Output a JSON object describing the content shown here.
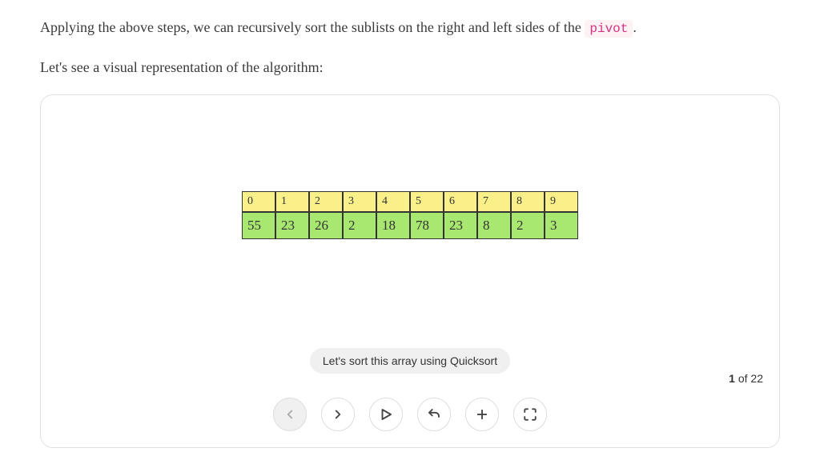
{
  "intro": {
    "paragraph1_prefix": "Applying the above steps, we can recursively sort the sublists on the right and left sides of the ",
    "code_token": "pivot",
    "paragraph1_suffix": ".",
    "paragraph2": "Let's see a visual representation of the algorithm:"
  },
  "array": {
    "indices": [
      "0",
      "1",
      "2",
      "3",
      "4",
      "5",
      "6",
      "7",
      "8",
      "9"
    ],
    "values": [
      "55",
      "23",
      "26",
      "2",
      "18",
      "78",
      "23",
      "8",
      "2",
      "3"
    ]
  },
  "caption": "Let's sort this array using Quicksort",
  "pager": {
    "current": "1",
    "of_label": "of",
    "total": "22"
  }
}
